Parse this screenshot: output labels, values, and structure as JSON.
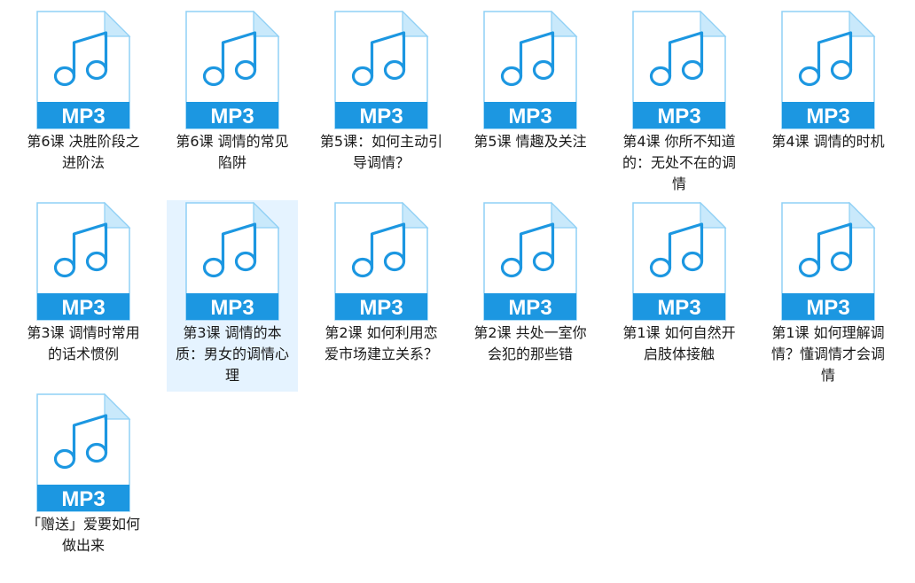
{
  "colors": {
    "accent": "#1c97e1",
    "page_fill": "#ffffff",
    "page_border": "#8fd0f5",
    "fold_fill": "#c9e9fb",
    "selection": "#e5f3ff",
    "label_text": "#ffffff"
  },
  "icon": {
    "name": "mp3-audio-file-icon",
    "badge": "MP3"
  },
  "files": [
    {
      "name": "第6课 决胜阶段之进阶法",
      "selected": false
    },
    {
      "name": "第6课 调情的常见陷阱",
      "selected": false
    },
    {
      "name": "第5课：如何主动引导调情？",
      "selected": false
    },
    {
      "name": "第5课 情趣及关注",
      "selected": false
    },
    {
      "name": "第4课 你所不知道的：无处不在的调情",
      "selected": false
    },
    {
      "name": "第4课 调情的时机",
      "selected": false
    },
    {
      "name": "第3课 调情时常用的话术惯例",
      "selected": false
    },
    {
      "name": "第3课 调情的本质：男女的调情心理",
      "selected": true
    },
    {
      "name": "第2课 如何利用恋爱市场建立关系？",
      "selected": false
    },
    {
      "name": "第2课 共处一室你会犯的那些错",
      "selected": false
    },
    {
      "name": "第1课 如何自然开启肢体接触",
      "selected": false
    },
    {
      "name": "第1课 如何理解调情？懂调情才会调情",
      "selected": false
    },
    {
      "name": "「赠送」爱要如何做出来",
      "selected": false
    }
  ]
}
